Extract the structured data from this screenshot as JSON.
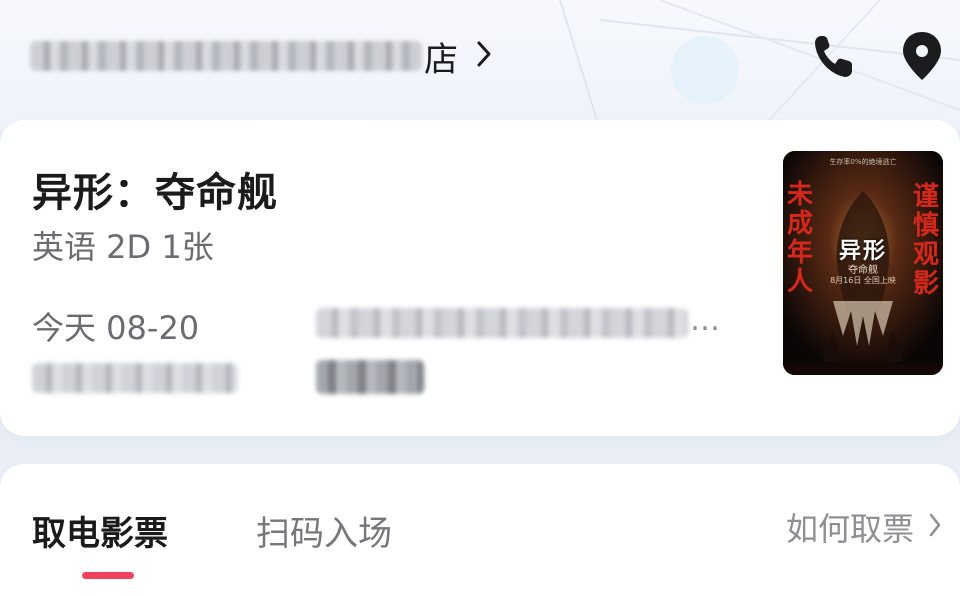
{
  "header": {
    "cinema_name_suffix": "店",
    "cinema_name_blurred": true,
    "chevron_icon": "chevron-right-icon",
    "phone_icon": "phone-icon",
    "location_icon": "location-pin-icon"
  },
  "order": {
    "movie_title": "异形：夺命舰",
    "meta": "英语 2D 1张",
    "date": "今天 08-20",
    "ellipsis": "…",
    "hall_blurred": true,
    "time_blurred": true,
    "seat_blurred": true
  },
  "poster": {
    "left_text": "未成年人",
    "right_text": "谨慎观影",
    "title": "异形",
    "subtitle": "夺命舰",
    "date_line": "8月16日 全国上映",
    "tagline": "生存率0%的绝境逃亡",
    "accent_color": "#d5281c"
  },
  "tickets": {
    "tabs": [
      {
        "label": "取电影票",
        "active": true
      },
      {
        "label": "扫码入场",
        "active": false
      }
    ],
    "howto_label": "如何取票",
    "indicator_color": "#f0405c"
  }
}
